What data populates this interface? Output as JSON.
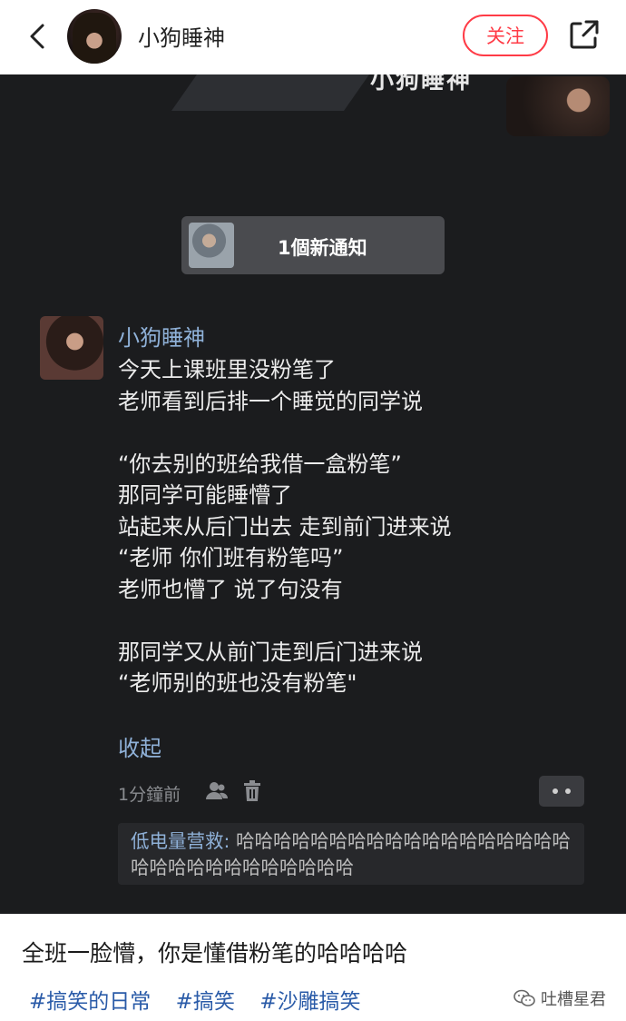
{
  "header": {
    "author_name": "小狗睡神",
    "follow_label": "关注"
  },
  "screenshot": {
    "cut_text": "小狗睡神",
    "notification": "1個新通知",
    "post": {
      "name": "小狗睡神",
      "lines": [
        "今天上课班里没粉笔了",
        "老师看到后排一个睡觉的同学说",
        "",
        "“你去别的班给我借一盒粉笔”",
        "那同学可能睡懵了",
        "站起来从后门出去 走到前门进来说",
        "“老师 你们班有粉笔吗”",
        "老师也懵了 说了句没有",
        "",
        "那同学又从前门走到后门进来说",
        "“老师别的班也没有粉笔\""
      ],
      "collapse_label": "收起",
      "time": "1分鐘前"
    },
    "comment": {
      "author": "低电量营救:",
      "text": " 哈哈哈哈哈哈哈哈哈哈哈哈哈哈哈哈哈哈哈哈哈哈哈哈哈哈哈哈哈哈"
    }
  },
  "caption": "全班一脸懵，你是懂借粉笔的哈哈哈哈",
  "tags": [
    "#搞笑的日常",
    "#搞笑",
    "#沙雕搞笑"
  ],
  "watermark": "吐槽星君"
}
